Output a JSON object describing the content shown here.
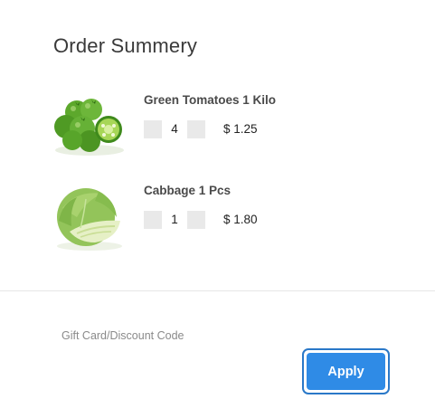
{
  "order": {
    "title": "Order Summery",
    "items": [
      {
        "name": "Green Tomatoes 1 Kilo",
        "quantity": "4",
        "price": "$ 1.25",
        "image_icon": "green-tomatoes-image"
      },
      {
        "name": "Cabbage 1 Pcs",
        "quantity": "1",
        "price": "$ 1.80",
        "image_icon": "cabbage-image"
      }
    ]
  },
  "discount": {
    "label": "Gift Card/Discount Code",
    "apply_label": "Apply"
  },
  "colors": {
    "accent": "#2f8be6",
    "accent_border": "#2a78c8",
    "stepper": "#e9e9e9",
    "tomato_green": "#5fae2c"
  }
}
